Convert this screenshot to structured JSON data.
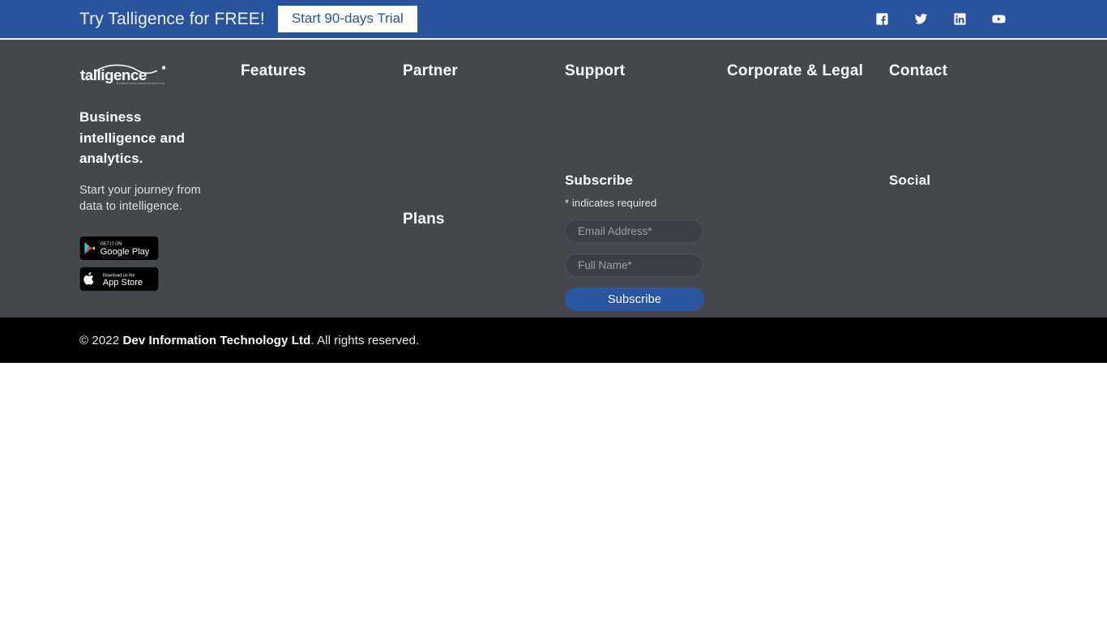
{
  "promo": {
    "text": "Try Talligence for FREE!",
    "cta_label": "Start 90-days Trial",
    "bg_color": "#2A539E",
    "social": [
      {
        "name": "facebook-icon",
        "label": "Facebook"
      },
      {
        "name": "twitter-icon",
        "label": "Twitter"
      },
      {
        "name": "linkedin-icon",
        "label": "LinkedIn"
      },
      {
        "name": "youtube-icon",
        "label": "YouTube"
      }
    ]
  },
  "footer": {
    "bg_color": "#44474C",
    "brand": {
      "logo_text": "talligence",
      "logo_tagline": "BUSINESS INTELLIGENCE & ANALYTICS",
      "headline": "Business intelligence and analytics.",
      "description": "Start your journey from data to intelligence.",
      "badges": [
        {
          "name": "google-play-badge",
          "small_text": "GET IT ON",
          "big_text": "Google Play"
        },
        {
          "name": "app-store-badge",
          "small_text": "Download on the",
          "big_text": "App Store"
        }
      ]
    },
    "columns": [
      {
        "key": "features",
        "heading": "Features",
        "items": []
      },
      {
        "key": "partner",
        "heading": "Partner",
        "items": [
          "Plans"
        ]
      },
      {
        "key": "support",
        "heading": "Support",
        "items": []
      },
      {
        "key": "corporate",
        "heading": "Corporate & Legal",
        "items": []
      },
      {
        "key": "contact",
        "heading": "Contact",
        "items": []
      }
    ],
    "subscribe": {
      "heading": "Subscribe",
      "required_note": "* indicates required",
      "email_placeholder": "Email Address*",
      "name_placeholder": "Full Name*",
      "email_value": "",
      "name_value": "",
      "button_label": "Subscribe",
      "button_color": "#2A569F"
    },
    "social_heading": "Social"
  },
  "copyright": {
    "prefix": "© 2022 ",
    "company": "Dev Information Technology Ltd",
    "suffix": ". All rights reserved.",
    "bg_color": "#000000"
  }
}
